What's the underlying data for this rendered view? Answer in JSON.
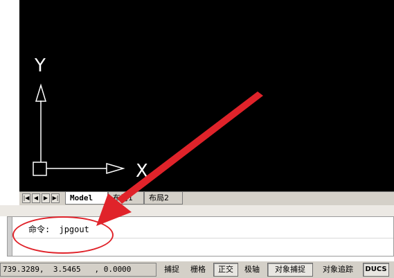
{
  "canvas": {
    "axis_y_label": "Y",
    "axis_x_label": "X",
    "background": "#000000",
    "axis_color": "#ffffff"
  },
  "tabs": {
    "nav_first": "|◀",
    "nav_prev": "◀",
    "nav_next": "▶",
    "nav_last": "▶|",
    "items": [
      "Model",
      "布局1",
      "布局2"
    ]
  },
  "command": {
    "prompt_label": "命令:",
    "prompt_value": "jpgout"
  },
  "status": {
    "coordinates": "739.3289,  3.5465   , 0.0000",
    "buttons": [
      "捕捉",
      "栅格",
      "正交",
      "极轴",
      "对象捕捉",
      "对象追踪",
      "DUCS"
    ]
  },
  "annotation": {
    "color": "#e0232a"
  }
}
